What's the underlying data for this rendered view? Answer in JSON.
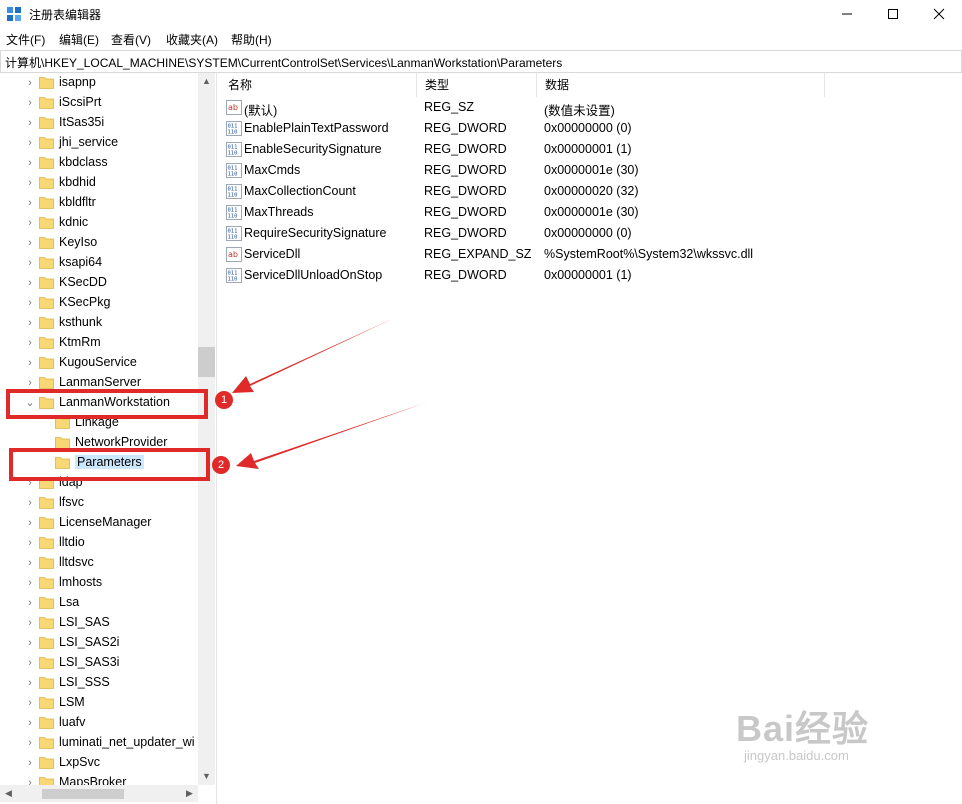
{
  "window": {
    "title": "注册表编辑器"
  },
  "menu": [
    "文件(F)",
    "编辑(E)",
    "查看(V)",
    "收藏夹(A)",
    "帮助(H)"
  ],
  "address": "计算机\\HKEY_LOCAL_MACHINE\\SYSTEM\\CurrentControlSet\\Services\\LanmanWorkstation\\Parameters",
  "tree": [
    {
      "label": "isapnp",
      "expander": "collapsed"
    },
    {
      "label": "iScsiPrt",
      "expander": "collapsed"
    },
    {
      "label": "ItSas35i",
      "expander": "collapsed"
    },
    {
      "label": "jhi_service",
      "expander": "collapsed"
    },
    {
      "label": "kbdclass",
      "expander": "collapsed"
    },
    {
      "label": "kbdhid",
      "expander": "collapsed"
    },
    {
      "label": "kbldfltr",
      "expander": "collapsed"
    },
    {
      "label": "kdnic",
      "expander": "collapsed"
    },
    {
      "label": "KeyIso",
      "expander": "collapsed"
    },
    {
      "label": "ksapi64",
      "expander": "collapsed"
    },
    {
      "label": "KSecDD",
      "expander": "collapsed"
    },
    {
      "label": "KSecPkg",
      "expander": "collapsed"
    },
    {
      "label": "ksthunk",
      "expander": "collapsed"
    },
    {
      "label": "KtmRm",
      "expander": "collapsed"
    },
    {
      "label": "KugouService",
      "expander": "collapsed"
    },
    {
      "label": "LanmanServer",
      "expander": "collapsed"
    },
    {
      "label": "LanmanWorkstation",
      "expander": "expanded"
    },
    {
      "label": "Linkage",
      "expander": "none",
      "child": true
    },
    {
      "label": "NetworkProvider",
      "expander": "none",
      "child": true
    },
    {
      "label": "Parameters",
      "expander": "none",
      "child": true,
      "selected": true
    },
    {
      "label": "ldap",
      "expander": "collapsed"
    },
    {
      "label": "lfsvc",
      "expander": "collapsed"
    },
    {
      "label": "LicenseManager",
      "expander": "collapsed"
    },
    {
      "label": "lltdio",
      "expander": "collapsed"
    },
    {
      "label": "lltdsvc",
      "expander": "collapsed"
    },
    {
      "label": "lmhosts",
      "expander": "collapsed"
    },
    {
      "label": "Lsa",
      "expander": "collapsed"
    },
    {
      "label": "LSI_SAS",
      "expander": "collapsed"
    },
    {
      "label": "LSI_SAS2i",
      "expander": "collapsed"
    },
    {
      "label": "LSI_SAS3i",
      "expander": "collapsed"
    },
    {
      "label": "LSI_SSS",
      "expander": "collapsed"
    },
    {
      "label": "LSM",
      "expander": "collapsed"
    },
    {
      "label": "luafv",
      "expander": "collapsed"
    },
    {
      "label": "luminati_net_updater_wi",
      "expander": "collapsed"
    },
    {
      "label": "LxpSvc",
      "expander": "collapsed"
    },
    {
      "label": "MapsBroker",
      "expander": "collapsed"
    }
  ],
  "list": {
    "columns": [
      "名称",
      "类型",
      "数据"
    ],
    "rows": [
      {
        "name": "(默认)",
        "type": "REG_SZ",
        "data": "(数值未设置)",
        "icon": "string-value-icon"
      },
      {
        "name": "EnablePlainTextPassword",
        "type": "REG_DWORD",
        "data": "0x00000000 (0)",
        "icon": "binary-value-icon"
      },
      {
        "name": "EnableSecuritySignature",
        "type": "REG_DWORD",
        "data": "0x00000001 (1)",
        "icon": "binary-value-icon"
      },
      {
        "name": "MaxCmds",
        "type": "REG_DWORD",
        "data": "0x0000001e (30)",
        "icon": "binary-value-icon"
      },
      {
        "name": "MaxCollectionCount",
        "type": "REG_DWORD",
        "data": "0x00000020 (32)",
        "icon": "binary-value-icon"
      },
      {
        "name": "MaxThreads",
        "type": "REG_DWORD",
        "data": "0x0000001e (30)",
        "icon": "binary-value-icon"
      },
      {
        "name": "RequireSecuritySignature",
        "type": "REG_DWORD",
        "data": "0x00000000 (0)",
        "icon": "binary-value-icon"
      },
      {
        "name": "ServiceDll",
        "type": "REG_EXPAND_SZ",
        "data": "%SystemRoot%\\System32\\wkssvc.dll",
        "icon": "string-value-icon"
      },
      {
        "name": "ServiceDllUnloadOnStop",
        "type": "REG_DWORD",
        "data": "0x00000001 (1)",
        "icon": "binary-value-icon"
      }
    ]
  },
  "annotations": {
    "badge1": "1",
    "badge2": "2"
  },
  "watermark": {
    "brand": "Bai经验",
    "url": "jingyan.baidu.com"
  },
  "colors": {
    "annotation": "#e02a2a",
    "selection": "#cce8ff",
    "folder": "#f8d775"
  }
}
